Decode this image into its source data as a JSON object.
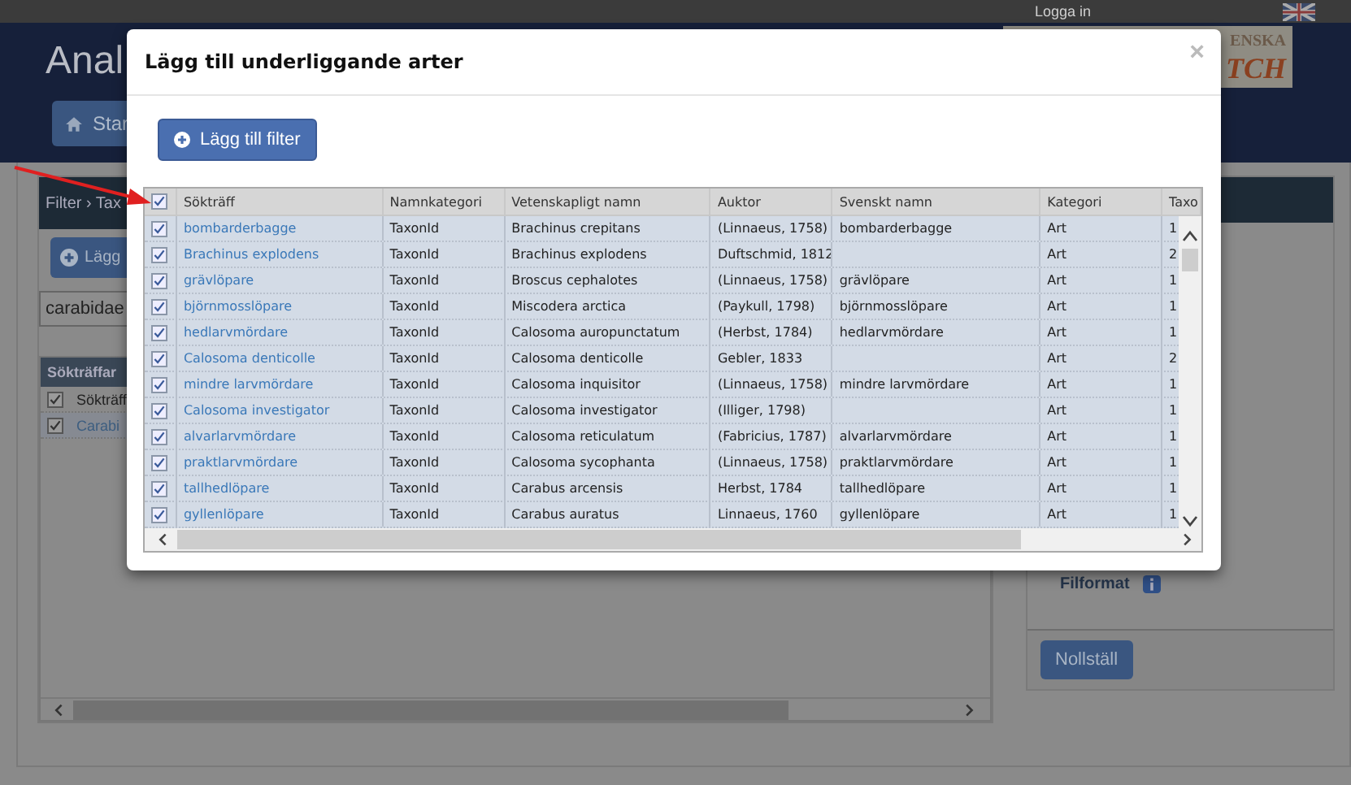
{
  "page": {
    "login_link": "Logga in",
    "title": "Anal",
    "logo": [
      "ENSKA",
      "TCH"
    ],
    "nav_button": "Star",
    "filter_panel": {
      "breadcrumb": "Filter › Tax",
      "add_button": "Lägg",
      "search": {
        "value": "carabidae"
      },
      "results": {
        "title": "Sökträffar",
        "header": {
          "checked": true,
          "label": "Sökträff"
        },
        "rows": [
          {
            "checked": true,
            "label": "Carabi"
          }
        ]
      }
    },
    "side_panel": {
      "file_format_label": "Filformat",
      "reset_button": "Nollställ"
    }
  },
  "dialog": {
    "title": "Lägg till underliggande arter",
    "close": "×",
    "add_button": "Lägg till filter",
    "grid": {
      "select_all": {
        "checked": true
      },
      "columns": [
        "Sökträff",
        "Namnkategori",
        "Vetenskapligt namn",
        "Auktor",
        "Svenskt namn",
        "Kategori",
        "Taxo"
      ],
      "rows": [
        {
          "checked": true,
          "cells": [
            "bombarderbagge",
            "TaxonId",
            "Brachinus crepitans",
            "(Linnaeus, 1758)",
            "bombarderbagge",
            "Art",
            "1"
          ]
        },
        {
          "checked": true,
          "cells": [
            "Brachinus explodens",
            "TaxonId",
            "Brachinus explodens",
            "Duftschmid, 1812",
            "",
            "Art",
            "2"
          ]
        },
        {
          "checked": true,
          "cells": [
            "grävlöpare",
            "TaxonId",
            "Broscus cephalotes",
            "(Linnaeus, 1758)",
            "grävlöpare",
            "Art",
            "1"
          ]
        },
        {
          "checked": true,
          "cells": [
            "björnmosslöpare",
            "TaxonId",
            "Miscodera arctica",
            "(Paykull, 1798)",
            "björnmosslöpare",
            "Art",
            "1"
          ]
        },
        {
          "checked": true,
          "cells": [
            "hedlarvmördare",
            "TaxonId",
            "Calosoma auropunctatum",
            "(Herbst, 1784)",
            "hedlarvmördare",
            "Art",
            "1"
          ]
        },
        {
          "checked": true,
          "cells": [
            "Calosoma denticolle",
            "TaxonId",
            "Calosoma denticolle",
            "Gebler, 1833",
            "",
            "Art",
            "2"
          ]
        },
        {
          "checked": true,
          "cells": [
            "mindre larvmördare",
            "TaxonId",
            "Calosoma inquisitor",
            "(Linnaeus, 1758)",
            "mindre larvmördare",
            "Art",
            "1"
          ]
        },
        {
          "checked": true,
          "cells": [
            "Calosoma investigator",
            "TaxonId",
            "Calosoma investigator",
            "(Illiger, 1798)",
            "",
            "Art",
            "1"
          ]
        },
        {
          "checked": true,
          "cells": [
            "alvarlarvmördare",
            "TaxonId",
            "Calosoma reticulatum",
            "(Fabricius, 1787)",
            "alvarlarvmördare",
            "Art",
            "1"
          ]
        },
        {
          "checked": true,
          "cells": [
            "praktlarvmördare",
            "TaxonId",
            "Calosoma sycophanta",
            "(Linnaeus, 1758)",
            "praktlarvmördare",
            "Art",
            "1"
          ]
        },
        {
          "checked": true,
          "cells": [
            "tallhedlöpare",
            "TaxonId",
            "Carabus arcensis",
            "Herbst, 1784",
            "tallhedlöpare",
            "Art",
            "1"
          ]
        },
        {
          "checked": true,
          "cells": [
            "gyllenlöpare",
            "TaxonId",
            "Carabus auratus",
            "Linnaeus, 1760",
            "gyllenlöpare",
            "Art",
            "1"
          ]
        }
      ]
    }
  }
}
